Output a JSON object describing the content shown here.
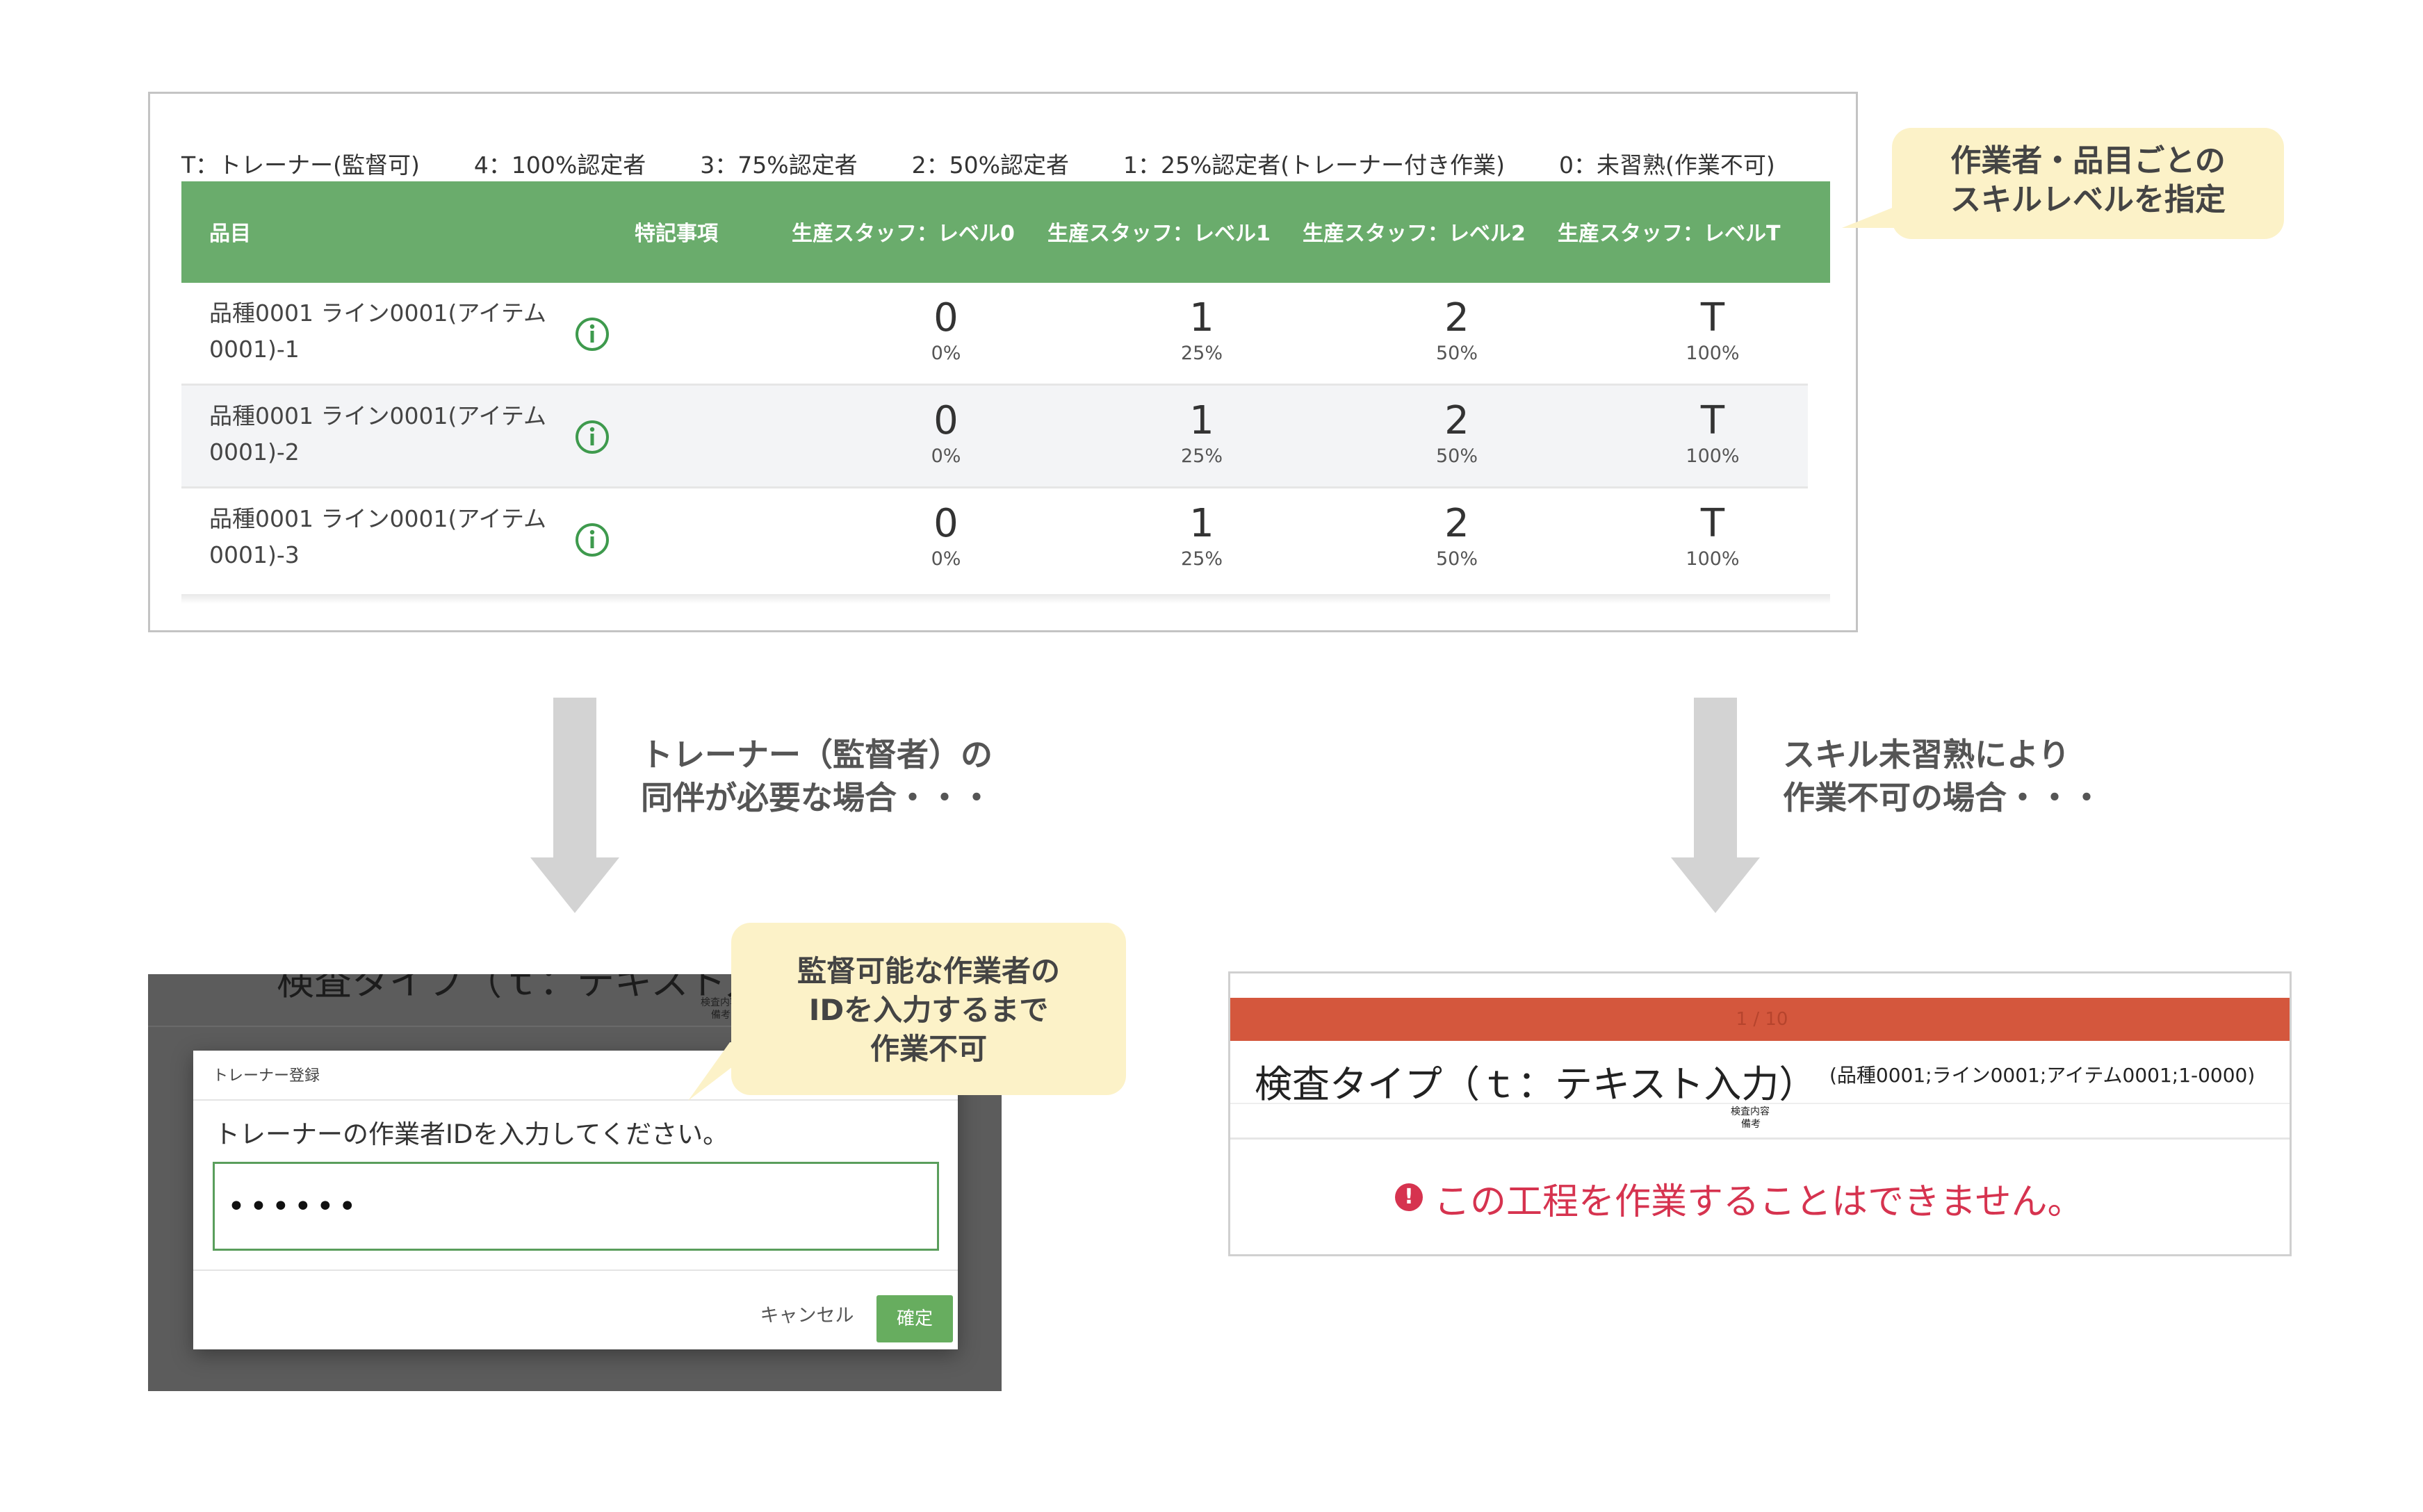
{
  "skill_table": {
    "legend": [
      "T：トレーナー(監督可)",
      "4：100%認定者",
      "3：75%認定者",
      "2：50%認定者",
      "1：25%認定者(トレーナー付き作業)",
      "0：未習熟(作業不可)"
    ],
    "headers": {
      "item": "品目",
      "notes": "特記事項",
      "level0": "生産スタッフ：レベル0",
      "level1": "生産スタッフ：レベル1",
      "level2": "生産スタッフ：レベル2",
      "levelT": "生産スタッフ：レベルT"
    },
    "rows": [
      {
        "label_line1": "品種0001 ライン0001(アイテム",
        "label_line2": "0001)-1",
        "cells": [
          {
            "level": "0",
            "pct": "0%"
          },
          {
            "level": "1",
            "pct": "25%"
          },
          {
            "level": "2",
            "pct": "50%"
          },
          {
            "level": "T",
            "pct": "100%"
          }
        ]
      },
      {
        "label_line1": "品種0001 ライン0001(アイテム",
        "label_line2": "0001)-2",
        "cells": [
          {
            "level": "0",
            "pct": "0%"
          },
          {
            "level": "1",
            "pct": "25%"
          },
          {
            "level": "2",
            "pct": "50%"
          },
          {
            "level": "T",
            "pct": "100%"
          }
        ]
      },
      {
        "label_line1": "品種0001 ライン0001(アイテム",
        "label_line2": "0001)-3",
        "cells": [
          {
            "level": "0",
            "pct": "0%"
          },
          {
            "level": "1",
            "pct": "25%"
          },
          {
            "level": "2",
            "pct": "50%"
          },
          {
            "level": "T",
            "pct": "100%"
          }
        ]
      }
    ]
  },
  "callouts": {
    "skill": [
      "作業者・品目ごとの",
      "スキルレベルを指定"
    ],
    "trainer": [
      "監督可能な作業者の",
      "IDを入力するまで",
      "作業不可"
    ]
  },
  "captions": {
    "left": [
      "トレーナー（監督者）の",
      "同伴が必要な場合・・・"
    ],
    "right": [
      "スキル未習熟により",
      "作業不可の場合・・・"
    ]
  },
  "trainer_dialog": {
    "bg_title": "検査タイプ（ｔ：テキスト入力）",
    "bg_sub1": "検査内容",
    "bg_sub2": "備考",
    "title": "トレーナー登録",
    "prompt": "トレーナーの作業者IDを入力してください。",
    "input_value": "••••••",
    "cancel_label": "キャンセル",
    "ok_label": "確定"
  },
  "blocked_screen": {
    "progress": "1 / 10",
    "title": "検査タイプ（ｔ：テキスト入力）",
    "meta": "(品種0001;ライン0001;アイテム0001;1-0000)",
    "sub1": "検査内容",
    "sub2": "備考",
    "alert_icon": "!",
    "alert": "この工程を作業することはできません。"
  },
  "colors": {
    "table_header": "#6aac6c",
    "callout_bg": "#fcf2c8",
    "progress_bar": "#d4573d",
    "alert": "#d6334f",
    "confirm_button": "#67ad5f",
    "arrow": "#d3d3d3"
  }
}
